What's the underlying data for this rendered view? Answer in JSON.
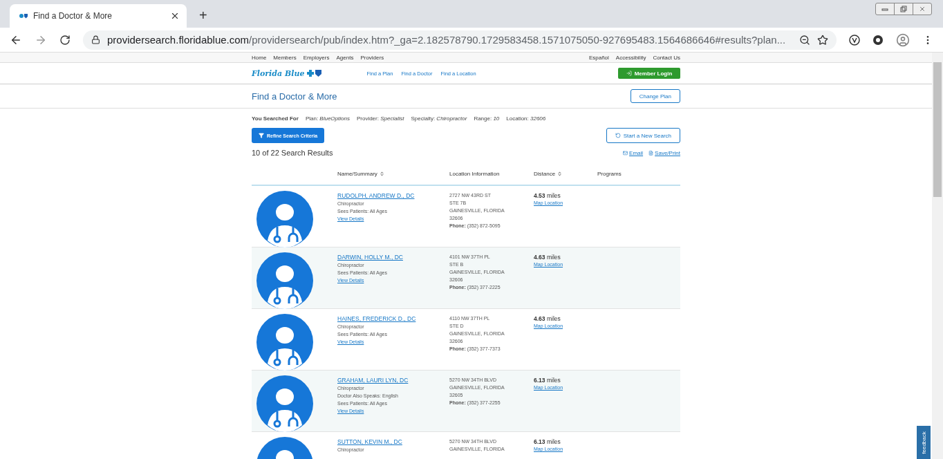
{
  "browser": {
    "tab_title": "Find a Doctor & More",
    "new_tab": "+",
    "url_host": "providersearch.floridablue.com",
    "url_path": "/providersearch/pub/index.htm?_ga=2.182578790.1729583458.1571075050-927695483.1564686646#results?plan..."
  },
  "top_nav": {
    "left": [
      "Home",
      "Members",
      "Employers",
      "Agents",
      "Providers"
    ],
    "right": [
      "Español",
      "Accessibility",
      "Contact Us"
    ]
  },
  "header": {
    "logo": "Florida Blue",
    "links": [
      "Find a Plan",
      "Find a Doctor",
      "Find a Location"
    ],
    "login": "Member Login"
  },
  "title_bar": {
    "title": "Find a Doctor & More",
    "button": "Change Plan"
  },
  "search_summary": {
    "label": "You Searched For",
    "criteria": [
      {
        "name": "Plan:",
        "value": "BlueOptions"
      },
      {
        "name": "Provider:",
        "value": "Specialist"
      },
      {
        "name": "Specialty:",
        "value": "Chiropractor"
      },
      {
        "name": "Range:",
        "value": "10"
      },
      {
        "name": "Location:",
        "value": "32606"
      }
    ]
  },
  "actions": {
    "refine": "Refine Search Criteria",
    "new_search": "Start a New Search",
    "count": "10 of 22 Search Results",
    "email": "Email",
    "save": "Save/Print"
  },
  "columns": [
    {
      "label": "Name/Summary",
      "sortable": true
    },
    {
      "label": "Location Information",
      "sortable": false
    },
    {
      "label": "Distance",
      "sortable": true
    },
    {
      "label": "Programs",
      "sortable": false
    }
  ],
  "providers": [
    {
      "name": "RUDOLPH, ANDREW D., DC",
      "details": [
        "Chiropractor",
        "Sees Patients: All Ages"
      ],
      "view": "View Details",
      "address": [
        "2727 NW 43RD ST",
        "STE 7B",
        "GAINESVILLE, FLORIDA",
        "32606"
      ],
      "phone_label": "Phone:",
      "phone": "(352) 872-5095",
      "distance": "4.53",
      "unit": "miles",
      "map": "Map Location"
    },
    {
      "name": "DARWIN, HOLLY M., DC",
      "details": [
        "Chiropractor",
        "Sees Patients: All Ages"
      ],
      "view": "View Details",
      "address": [
        "4101 NW 37TH PL",
        "STE B",
        "GAINESVILLE, FLORIDA",
        "32606"
      ],
      "phone_label": "Phone:",
      "phone": "(352) 377-2225",
      "distance": "4.63",
      "unit": "miles",
      "map": "Map Location"
    },
    {
      "name": "HAINES, FREDERICK D., DC",
      "details": [
        "Chiropractor",
        "Sees Patients: All Ages"
      ],
      "view": "View Details",
      "address": [
        "4110 NW 37TH PL",
        "STE D",
        "GAINESVILLE, FLORIDA",
        "32606"
      ],
      "phone_label": "Phone:",
      "phone": "(352) 377-7373",
      "distance": "4.63",
      "unit": "miles",
      "map": "Map Location"
    },
    {
      "name": "GRAHAM, LAURI LYN, DC",
      "details": [
        "Chiropractor",
        "Doctor Also Speaks: English",
        "Sees Patients: All Ages"
      ],
      "view": "View Details",
      "address": [
        "5270 NW 34TH BLVD",
        "GAINESVILLE, FLORIDA",
        "32605"
      ],
      "phone_label": "Phone:",
      "phone": "(352) 377-2255",
      "distance": "6.13",
      "unit": "miles",
      "map": "Map Location"
    },
    {
      "name": "SUTTON, KEVIN M., DC",
      "details": [
        "Chiropractor"
      ],
      "address": [
        "5270 NW 34TH BLVD",
        "GAINESVILLE, FLORIDA"
      ],
      "distance": "6.13",
      "unit": "miles",
      "map": "Map Location"
    }
  ],
  "feedback": "feedback"
}
